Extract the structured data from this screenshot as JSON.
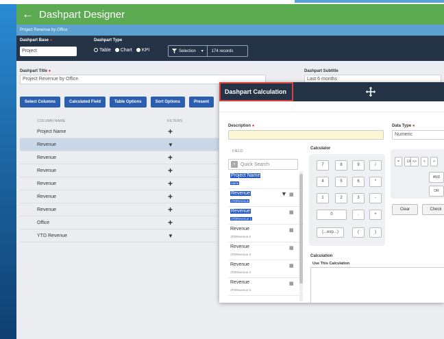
{
  "app": {
    "back_arrow": "←",
    "title": "Dashpart Designer",
    "breadcrumb": "Project Revenue by Office"
  },
  "config": {
    "base_label": "Dashpart Base",
    "base_value": "Project",
    "type_label": "Dashpart Type",
    "type_options": [
      "Table",
      "Chart",
      "KPI"
    ],
    "selected_type": "Table",
    "selection_label": "Selection",
    "records": "174 records"
  },
  "form": {
    "title_label": "Dashpart Title",
    "title_value": "Project Revenue  by Office",
    "subtitle_label": "Dashpart Subtitle",
    "subtitle_value": "Last 6 months"
  },
  "buttons": [
    "Select Columns",
    "Calculated Field",
    "Table Options",
    "Sort Options",
    "Present"
  ],
  "table": {
    "col_name": "COLUMN NAME",
    "col_filters": "FILTERS",
    "rows": [
      {
        "name": "Project Name",
        "icon": "+",
        "selected": false
      },
      {
        "name": "Revenue",
        "icon": "▼",
        "selected": true
      },
      {
        "name": "Revenue",
        "icon": "+",
        "selected": false
      },
      {
        "name": "Revenue",
        "icon": "+",
        "selected": false
      },
      {
        "name": "Revenue",
        "icon": "+",
        "selected": false
      },
      {
        "name": "Revenue",
        "icon": "+",
        "selected": false
      },
      {
        "name": "Revenue",
        "icon": "+",
        "selected": false
      },
      {
        "name": "Office",
        "icon": "+",
        "selected": false
      },
      {
        "name": "YTD Revenue",
        "icon": "▼",
        "selected": false
      }
    ]
  },
  "modal": {
    "title": "Dashpart Calculation",
    "description_label": "Description",
    "datatype_label": "Data Type",
    "datatype_value": "Numeric",
    "field_header": "FIELD",
    "search_placeholder": "Quick Search",
    "fields": [
      {
        "name": "Project Name",
        "sub": "name",
        "highlight": true,
        "filter": false,
        "calc": false
      },
      {
        "name": "Revenue",
        "sub": "JTDRevenue",
        "highlight": true,
        "filter": true,
        "calc": true
      },
      {
        "name": "Revenue",
        "sub": "JTDRevenue 1",
        "highlight": true,
        "filter": false,
        "calc": true
      },
      {
        "name": "Revenue",
        "sub": "JTDRevenue 2",
        "highlight": false,
        "filter": false,
        "calc": true
      },
      {
        "name": "Revenue",
        "sub": "JTDRevenue 3",
        "highlight": false,
        "filter": false,
        "calc": true
      },
      {
        "name": "Revenue",
        "sub": "JTDRevenue 4",
        "highlight": false,
        "filter": false,
        "calc": true
      },
      {
        "name": "Revenue",
        "sub": "JTDRevenue 5",
        "highlight": false,
        "filter": false,
        "calc": true
      }
    ],
    "calculator_label": "Calculator",
    "keys": [
      [
        "7",
        "8",
        "9",
        "/"
      ],
      [
        "4",
        "5",
        "6",
        "*"
      ],
      [
        "1",
        "2",
        "3",
        "-"
      ],
      [
        "0",
        ".",
        "+"
      ],
      [
        "(...exp...)",
        "(",
        ")"
      ]
    ],
    "ops": [
      "=",
      "LIKE",
      "<>",
      "<",
      ">"
    ],
    "and_label": "AND",
    "or_label": "OR",
    "clear_label": "Clear",
    "check_label": "Check",
    "calculation_label": "Calculation",
    "use_label": "Use This Calculation"
  },
  "colors": {
    "header": "#5cab52",
    "subbar": "#5ba0cf",
    "darkbar": "#253346",
    "button_blue": "#2b5eb0",
    "highlight": "#2457c5",
    "modal_outline": "#d94040"
  }
}
